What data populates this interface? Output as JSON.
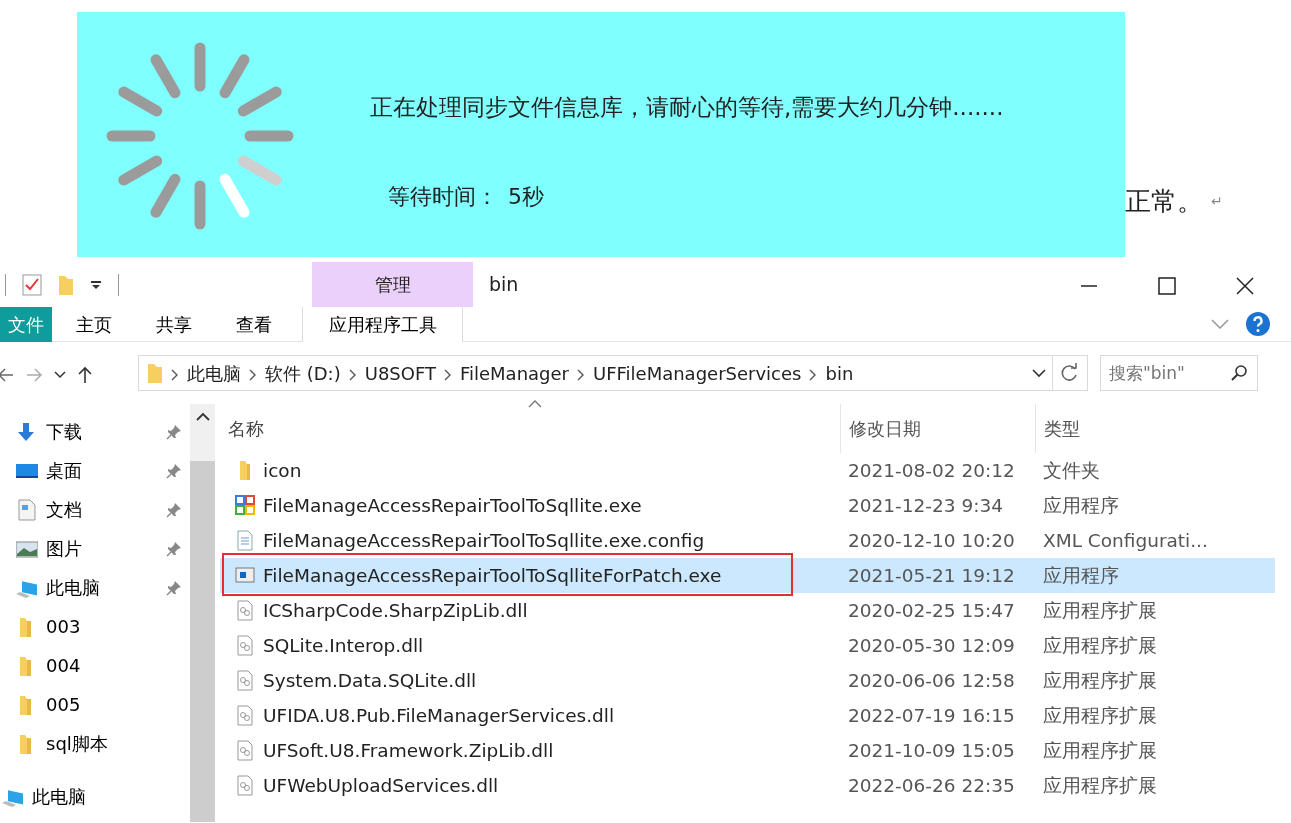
{
  "popup": {
    "message": "正在处理同步文件信息库，请耐心的等待,需要大约几分钟.......",
    "wait_label": "等待时间：",
    "wait_value": "5秒"
  },
  "document": {
    "text": "正常。",
    "mark": "↵"
  },
  "window": {
    "title": "bin",
    "context_tab": "管理"
  },
  "ribbon_tabs": [
    {
      "label": "文件",
      "kind": "file"
    },
    {
      "label": "主页",
      "kind": "normal"
    },
    {
      "label": "共享",
      "kind": "normal"
    },
    {
      "label": "查看",
      "kind": "normal"
    },
    {
      "label": "应用程序工具",
      "kind": "context"
    }
  ],
  "breadcrumbs": [
    "此电脑",
    "软件 (D:)",
    "U8SOFT",
    "FileManager",
    "UFFileManagerServices",
    "bin"
  ],
  "search": {
    "placeholder": "搜索\"bin\""
  },
  "sidebar": {
    "items": [
      {
        "label": "下载",
        "kind": "download",
        "pinned": true
      },
      {
        "label": "桌面",
        "kind": "desktop",
        "pinned": true
      },
      {
        "label": "文档",
        "kind": "document",
        "pinned": true
      },
      {
        "label": "图片",
        "kind": "pictures",
        "pinned": true
      },
      {
        "label": "此电脑",
        "kind": "computer",
        "pinned": true
      },
      {
        "label": "003",
        "kind": "folder",
        "pinned": false
      },
      {
        "label": "004",
        "kind": "folder",
        "pinned": false
      },
      {
        "label": "005",
        "kind": "folder",
        "pinned": false
      },
      {
        "label": "sql脚本",
        "kind": "folder",
        "pinned": false
      },
      {
        "label": "此电脑",
        "kind": "root",
        "pinned": false
      }
    ]
  },
  "table": {
    "columns": [
      "名称",
      "修改日期",
      "类型"
    ],
    "rows": [
      {
        "name": "icon",
        "date": "2021-08-02 20:12",
        "type": "文件夹",
        "kind": "folder",
        "selected": false,
        "framed": false
      },
      {
        "name": "FileManageAccessRepairToolToSqllite.exe",
        "date": "2021-12-23 9:34",
        "type": "应用程序",
        "kind": "app",
        "selected": false,
        "framed": false
      },
      {
        "name": "FileManageAccessRepairToolToSqllite.exe.config",
        "date": "2020-12-10 10:20",
        "type": "XML Configurati...",
        "kind": "config",
        "selected": false,
        "framed": false
      },
      {
        "name": "FileManageAccessRepairToolToSqlliteForPatch.exe",
        "date": "2021-05-21 19:12",
        "type": "应用程序",
        "kind": "window",
        "selected": true,
        "framed": true
      },
      {
        "name": "ICSharpCode.SharpZipLib.dll",
        "date": "2020-02-25 15:47",
        "type": "应用程序扩展",
        "kind": "dll",
        "selected": false,
        "framed": false
      },
      {
        "name": "SQLite.Interop.dll",
        "date": "2020-05-30 12:09",
        "type": "应用程序扩展",
        "kind": "dll",
        "selected": false,
        "framed": false
      },
      {
        "name": "System.Data.SQLite.dll",
        "date": "2020-06-06 12:58",
        "type": "应用程序扩展",
        "kind": "dll",
        "selected": false,
        "framed": false
      },
      {
        "name": "UFIDA.U8.Pub.FileManagerServices.dll",
        "date": "2022-07-19 16:15",
        "type": "应用程序扩展",
        "kind": "dll",
        "selected": false,
        "framed": false
      },
      {
        "name": "UFSoft.U8.Framework.ZipLib.dll",
        "date": "2021-10-09 15:05",
        "type": "应用程序扩展",
        "kind": "dll",
        "selected": false,
        "framed": false
      },
      {
        "name": "UFWebUploadServices.dll",
        "date": "2022-06-26 22:35",
        "type": "应用程序扩展",
        "kind": "dll",
        "selected": false,
        "framed": false
      }
    ]
  }
}
